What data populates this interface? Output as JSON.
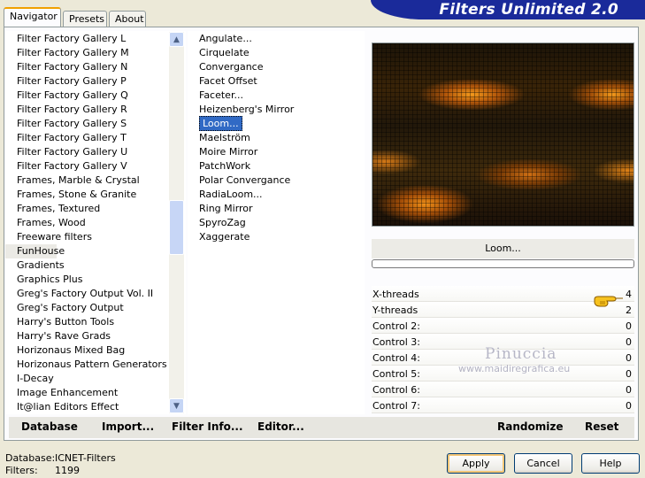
{
  "title": "Filters Unlimited 2.0",
  "tabs": [
    {
      "label": "Navigator",
      "active": true
    },
    {
      "label": "Presets",
      "active": false
    },
    {
      "label": "About",
      "active": false
    }
  ],
  "categories": [
    "Filter Factory Gallery L",
    "Filter Factory Gallery M",
    "Filter Factory Gallery N",
    "Filter Factory Gallery P",
    "Filter Factory Gallery Q",
    "Filter Factory Gallery R",
    "Filter Factory Gallery S",
    "Filter Factory Gallery T",
    "Filter Factory Gallery U",
    "Filter Factory Gallery V",
    "Frames, Marble & Crystal",
    "Frames, Stone & Granite",
    "Frames, Textured",
    "Frames, Wood",
    "Freeware filters",
    "FunHouse",
    "Gradients",
    "Graphics Plus",
    "Greg's Factory Output Vol. II",
    "Greg's Factory Output",
    "Harry's Button Tools",
    "Harry's Rave Grads",
    "Horizonaus Mixed Bag",
    "Horizonaus Pattern Generators",
    "I-Decay",
    "Image Enhancement",
    "It@lian Editors Effect"
  ],
  "selected_category": "FunHouse",
  "filters": [
    "Angulate...",
    "Cirquelate",
    "Convergance",
    "Facet Offset",
    "Faceter...",
    "Heizenberg's Mirror",
    "Loom...",
    "Maelström",
    "Moire Mirror",
    "PatchWork",
    "Polar Convergance",
    "RadiaLoom...",
    "Ring Mirror",
    "SpyroZag",
    "Xaggerate"
  ],
  "selected_filter": "Loom...",
  "filter_name": "Loom...",
  "controls": [
    {
      "label": "X-threads",
      "value": "4"
    },
    {
      "label": "Y-threads",
      "value": "2"
    },
    {
      "label": "Control 2:",
      "value": "0"
    },
    {
      "label": "Control 3:",
      "value": "0"
    },
    {
      "label": "Control 4:",
      "value": "0"
    },
    {
      "label": "Control 5:",
      "value": "0"
    },
    {
      "label": "Control 6:",
      "value": "0"
    },
    {
      "label": "Control 7:",
      "value": "0"
    }
  ],
  "watermark": {
    "name": "Pinuccia",
    "url": "www.maidiregrafica.eu"
  },
  "bottom_buttons": {
    "database": "Database",
    "import": "Import...",
    "filter_info": "Filter Info...",
    "editor": "Editor...",
    "randomize": "Randomize",
    "reset": "Reset"
  },
  "status": {
    "database_label": "Database:",
    "database_value": "ICNET-Filters",
    "filters_label": "Filters:",
    "filters_value": "1199"
  },
  "dialog_buttons": {
    "apply": "Apply",
    "cancel": "Cancel",
    "help": "Help"
  },
  "colors": {
    "title_bar": "#1a2a9a",
    "selection": "#316ac5",
    "tab_highlight": "#f0a000"
  },
  "icons": {
    "scroll_up": "scroll-up-arrow-icon",
    "scroll_down": "scroll-down-arrow-icon",
    "hand": "pointing-hand-icon"
  }
}
